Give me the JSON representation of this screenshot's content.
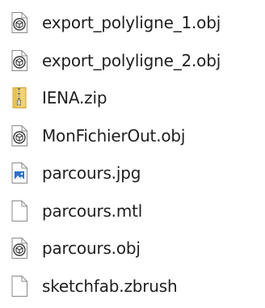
{
  "files": [
    {
      "name": "export_polyligne_1.obj",
      "icon": "3d-object-file-icon"
    },
    {
      "name": "export_polyligne_2.obj",
      "icon": "3d-object-file-icon"
    },
    {
      "name": "IENA.zip",
      "icon": "zip-folder-icon"
    },
    {
      "name": "MonFichierOut.obj",
      "icon": "3d-object-file-icon"
    },
    {
      "name": "parcours.jpg",
      "icon": "image-file-icon"
    },
    {
      "name": "parcours.mtl",
      "icon": "blank-file-icon"
    },
    {
      "name": "parcours.obj",
      "icon": "3d-object-file-icon"
    },
    {
      "name": "sketchfab.zbrush",
      "icon": "blank-file-icon"
    }
  ],
  "colors": {
    "text": "#1f1f1f",
    "zip_yellow": "#e8c24a",
    "image_blue": "#2b6fc7",
    "outline": "#8a8a8a"
  }
}
